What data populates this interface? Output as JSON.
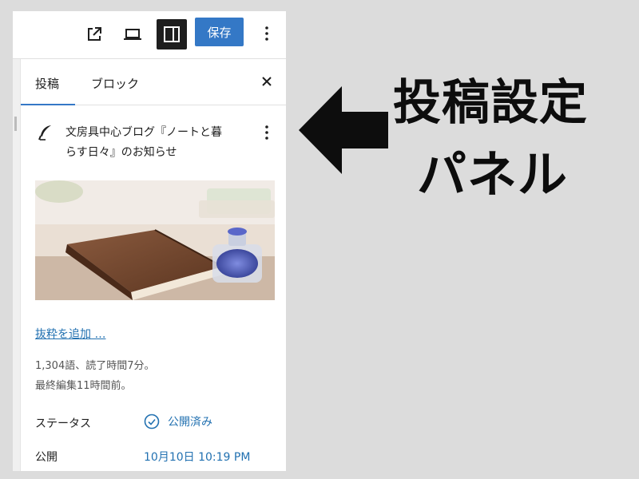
{
  "toolbar": {
    "save_label": "保存",
    "icons": [
      "external-link-icon",
      "laptop-preview-icon",
      "sidebar-toggle-icon",
      "more-vertical-icon"
    ]
  },
  "tabs": [
    {
      "label": "投稿",
      "active": true
    },
    {
      "label": "ブロック",
      "active": false
    }
  ],
  "post": {
    "title_line1": "文房具中心ブログ『ノートと暮",
    "title_line2": "らす日々』のお知らせ",
    "excerpt_link": "抜粋を追加 …",
    "stats_line1": "1,304語、読了時間7分。",
    "stats_line2": "最終編集11時間前。"
  },
  "meta": {
    "status_label": "ステータス",
    "status_value": "公開済み",
    "publish_label": "公開",
    "publish_value": "10月10日 10:19 PM"
  },
  "annotation": {
    "line1": "投稿設定",
    "line2": "パネル"
  },
  "colors": {
    "accent": "#3478c6",
    "link": "#2271b1",
    "background": "#dcdcdc"
  }
}
